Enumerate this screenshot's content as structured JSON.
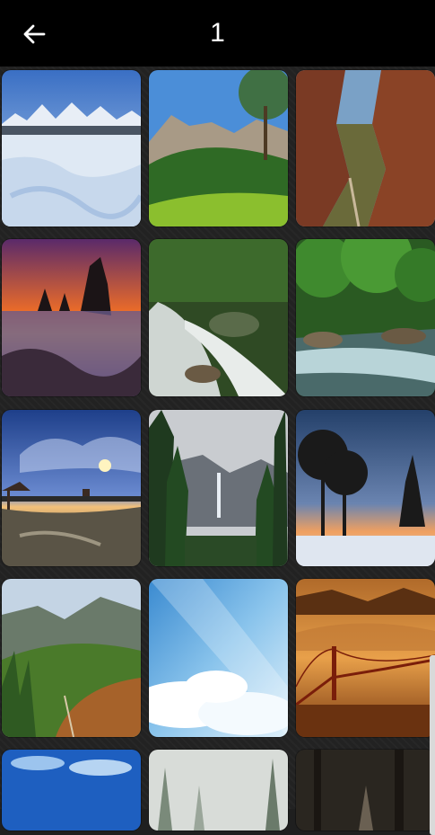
{
  "header": {
    "title": "1",
    "back_icon": "arrow-left-icon"
  },
  "gallery": {
    "images": [
      "snowy-mountain-field",
      "green-meadow-mountains",
      "red-rock-canyon",
      "sea-stacks-sunset",
      "forest-rapids",
      "forest-stream",
      "pier-sunset-clouds",
      "misty-valley-waterfall",
      "pines-snow-sunset",
      "autumn-mountain-valley",
      "sky-sunbeam-clouds",
      "golden-gate-fog",
      "blue-sky-clouds",
      "misty-pine-forest",
      "dark-forest-path"
    ]
  },
  "colors": {
    "header_bg": "#000000",
    "grid_bg": "#222222"
  }
}
